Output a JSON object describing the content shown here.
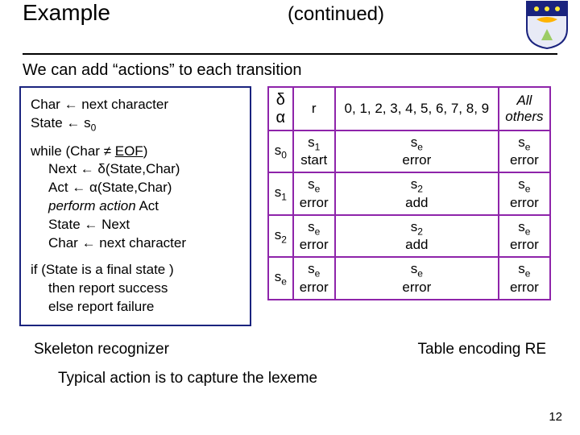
{
  "header": {
    "title_left": "Example",
    "title_right": "(continued)"
  },
  "subtitle": "We can add “actions” to each transition",
  "algorithm": {
    "l1a": "Char ← next character",
    "l1b": "State ← s",
    "l1b_sub": "0",
    "l2a": "while (Char ≠ ",
    "l2a_eof": "EOF",
    "l2a_end": ")",
    "l2b": "Next ← δ(State,Char)",
    "l2c": "Act   ← α(State,Char)",
    "l2d_a": "perform action",
    "l2d_b": " Act",
    "l2e": "State ← Next",
    "l2f": "Char ← next character",
    "l3a": "if (State is a final state )",
    "l3b": "then report success",
    "l3c": "else report failure"
  },
  "table": {
    "head": {
      "da_top": "δ",
      "da_bot": "α",
      "c1": "r",
      "c2": "0, 1, 2, 3, 4, 5, 6, 7, 8, 9",
      "c3_a": "All",
      "c3_b": "others"
    },
    "rows": [
      {
        "state": "s",
        "sub": "0",
        "c1a": "s",
        "c1s": "1",
        "c1b": "start",
        "c2a": "s",
        "c2s": "e",
        "c2b": "error",
        "c3a": "s",
        "c3s": "e",
        "c3b": "error"
      },
      {
        "state": "s",
        "sub": "1",
        "c1a": "s",
        "c1s": "e",
        "c1b": "error",
        "c2a": "s",
        "c2s": "2",
        "c2b": "add",
        "c3a": "s",
        "c3s": "e",
        "c3b": "error"
      },
      {
        "state": "s",
        "sub": "2",
        "c1a": "s",
        "c1s": "e",
        "c1b": "error",
        "c2a": "s",
        "c2s": "2",
        "c2b": "add",
        "c3a": "s",
        "c3s": "e",
        "c3b": "error"
      },
      {
        "state": "s",
        "sub": "e",
        "c1a": "s",
        "c1s": "e",
        "c1b": "error",
        "c2a": "s",
        "c2s": "e",
        "c2b": "error",
        "c3a": "s",
        "c3s": "e",
        "c3b": "error"
      }
    ]
  },
  "captions": {
    "left": "Skeleton recognizer",
    "right": "Table encoding RE"
  },
  "footer": "Typical action is to capture the lexeme",
  "pagenum": "12"
}
